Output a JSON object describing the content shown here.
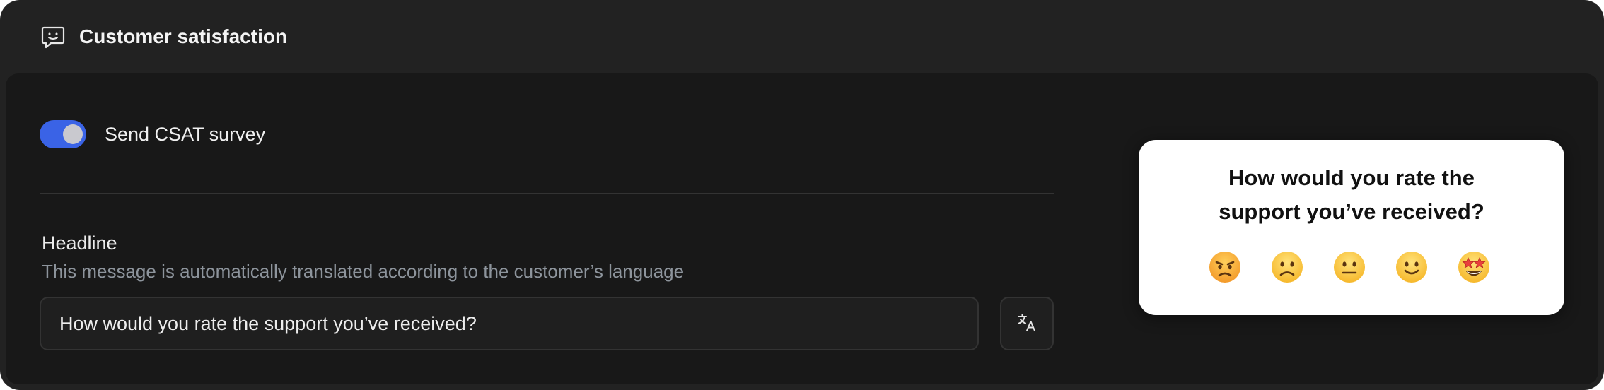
{
  "header": {
    "title": "Customer satisfaction",
    "icon": "chat-smile-icon"
  },
  "settings": {
    "csat_toggle": {
      "label": "Send CSAT survey",
      "enabled": true,
      "color": "#3a63e6"
    },
    "headline": {
      "title": "Headline",
      "hint": "This message is automatically translated according to the customer’s language",
      "value": "How would you rate the support you’ve received?",
      "translate_icon": "translate-icon"
    }
  },
  "preview": {
    "title_line1": "How would you rate the",
    "title_line2": "support you’ve received?",
    "ratings": [
      {
        "name": "angry",
        "icon": "angry-face-icon"
      },
      {
        "name": "sad",
        "icon": "slightly-frowning-face-icon"
      },
      {
        "name": "neutral",
        "icon": "neutral-face-icon"
      },
      {
        "name": "happy",
        "icon": "slightly-smiling-face-icon"
      },
      {
        "name": "star-struck",
        "icon": "star-struck-face-icon"
      }
    ]
  }
}
